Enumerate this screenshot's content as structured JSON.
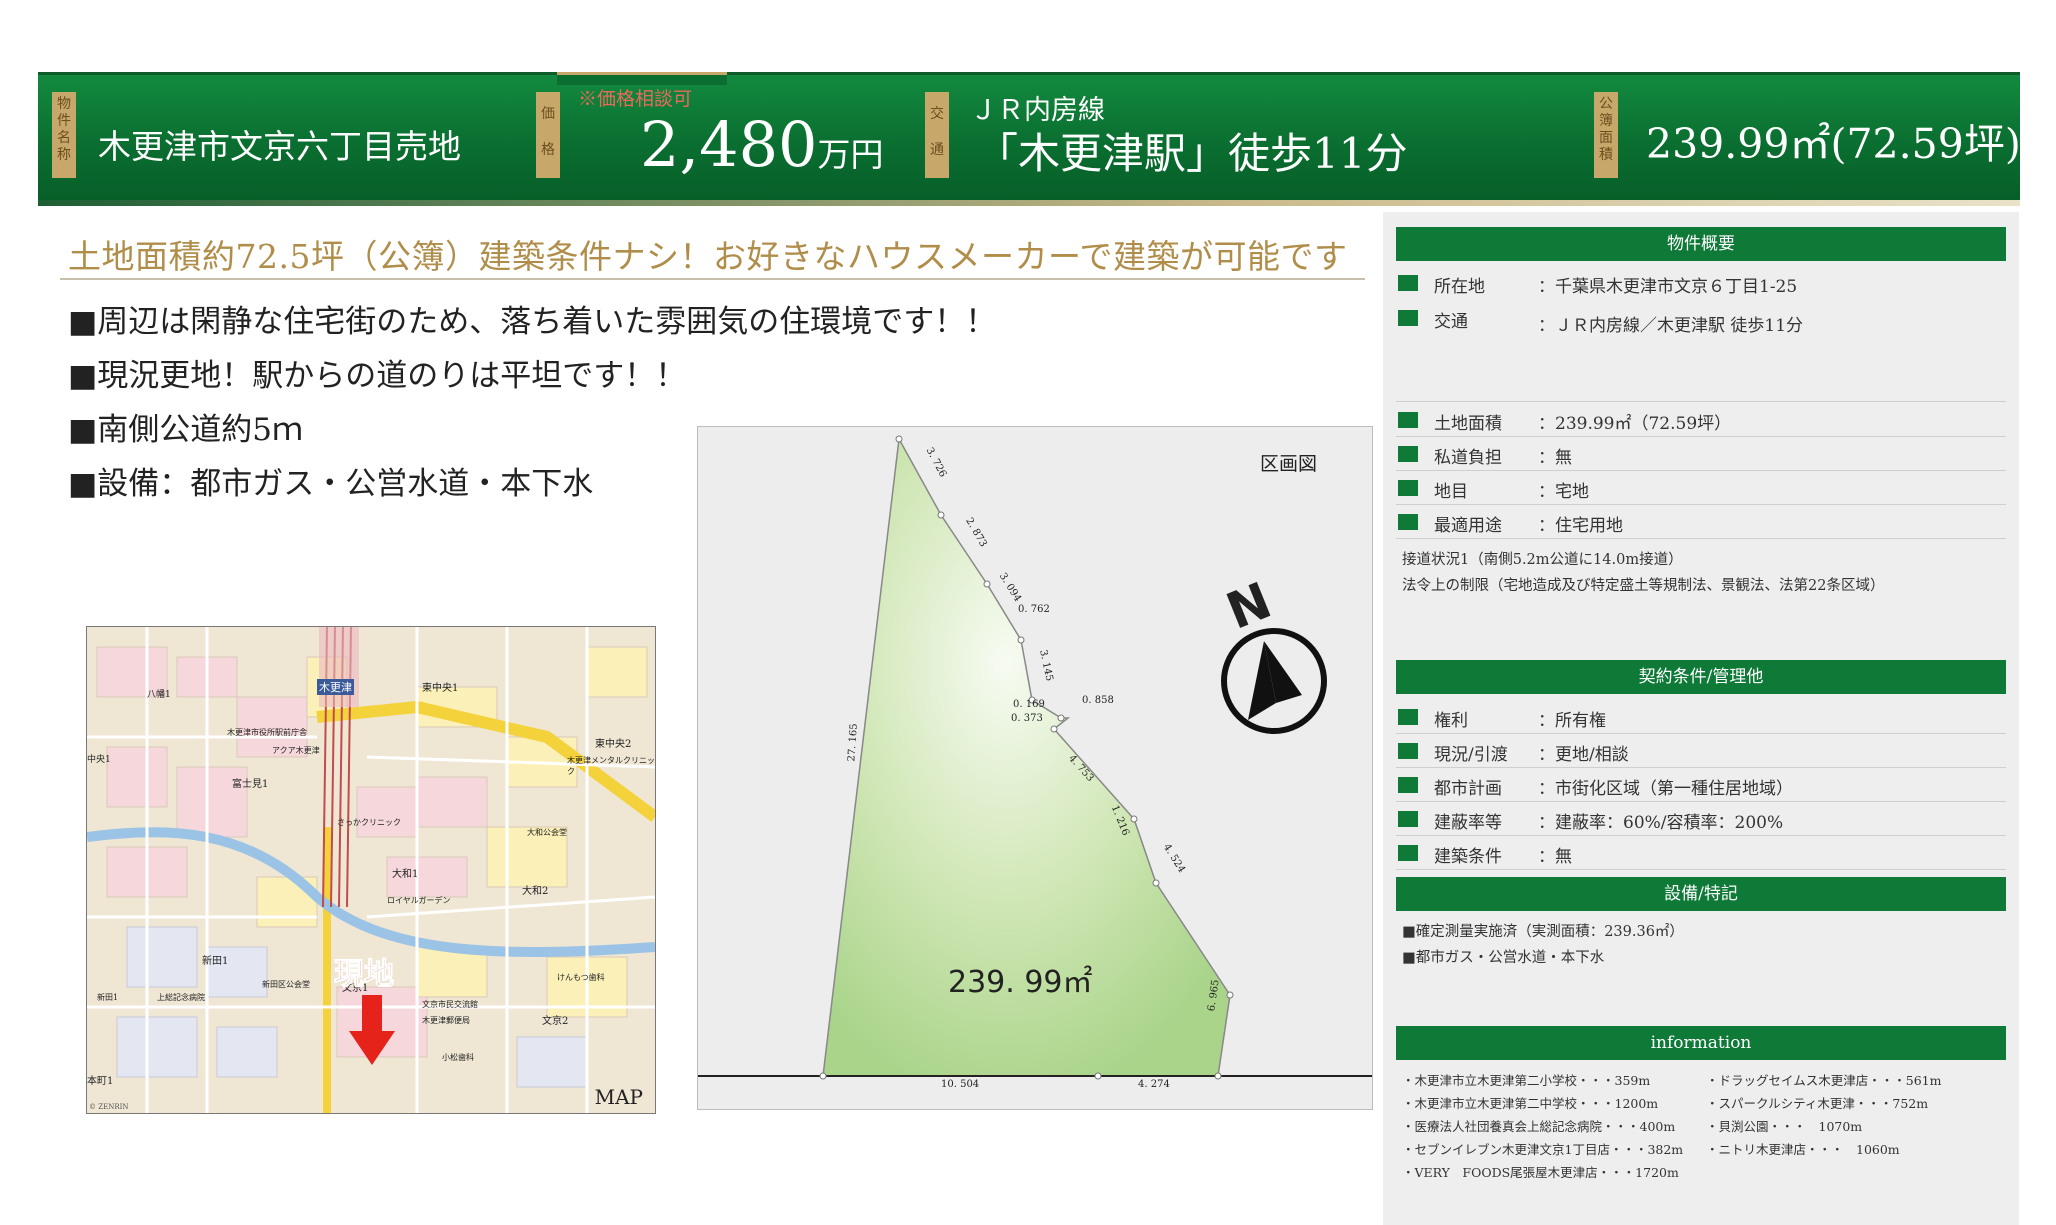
{
  "header": {
    "name_label": "物件名称",
    "property_name": "木更津市文京六丁目売地",
    "price_label": "価格",
    "price_note": "※価格相談可",
    "price_value": "2,480",
    "price_unit": "万円",
    "access_label": "交通",
    "access_line": "ＪＲ内房線",
    "access_station": "「木更津駅」徒歩11分",
    "area_label": "公簿面積",
    "area_value": "239.99㎡(72.59坪)"
  },
  "main": {
    "catch_copy": "土地面積約72.5坪（公簿）建築条件ナシ！お好きなハウスメーカーで建築が可能です",
    "bullets": [
      "■周辺は閑静な住宅街のため、落ち着いた雰囲気の住環境です！！",
      "■現況更地！駅からの道のりは平坦です！！",
      "■南側公道約5ｍ",
      "■設備：都市ガス・公営水道・本下水"
    ]
  },
  "map": {
    "caption": "MAP",
    "current_location": "現地",
    "labels": [
      "木更津",
      "東中央1",
      "東中央2",
      "富士見1",
      "大和1",
      "大和2",
      "新田1",
      "文京1",
      "文京2",
      "本町1",
      "八幡1",
      "中央1",
      "木更津市役所駅前庁舎",
      "木更津メンタルクリニック",
      "アクア木更津",
      "さっかクリニック",
      "ロイヤルガーデン",
      "けんもつ歯科",
      "文京市民交流館",
      "小松歯科",
      "上総記念病院",
      "新田区公会堂",
      "木更津郵便局",
      "大和公会堂",
      "新田1"
    ],
    "copyright": "© ZENRIN"
  },
  "plot": {
    "title": "区画図",
    "area": "239. 99㎡",
    "north": "N",
    "dimensions": [
      "3. 726",
      "2. 873",
      "3. 094",
      "0. 762",
      "3. 145",
      "0. 169",
      "0. 858",
      "0. 373",
      "4. 753",
      "1. 216",
      "4. 524",
      "6. 965",
      "4. 274",
      "10. 504",
      "27. 165"
    ]
  },
  "summary": {
    "title": "物件概要",
    "rows1": [
      {
        "label": "所在地",
        "value": "：千葉県木更津市文京６丁目1-25"
      },
      {
        "label": "交通",
        "value": "：ＪＲ内房線／木更津駅 徒歩11分"
      }
    ],
    "rows2": [
      {
        "label": "土地面積",
        "value": "：239.99㎡（72.59坪）"
      },
      {
        "label": "私道負担",
        "value": "：無"
      },
      {
        "label": "地目",
        "value": "：宅地"
      },
      {
        "label": "最適用途",
        "value": "：住宅用地"
      }
    ],
    "note1": "接道状況1（南側5.2m公道に14.0m接道）",
    "note2": "法令上の制限（宅地造成及び特定盛土等規制法、景観法、法第22条区域）"
  },
  "contract": {
    "title": "契約条件/管理他",
    "rows": [
      {
        "label": "権利",
        "value": "：所有権"
      },
      {
        "label": "現況/引渡",
        "value": "：更地/相談"
      },
      {
        "label": "都市計画",
        "value": "：市街化区域（第一種住居地域）"
      },
      {
        "label": "建蔽率等",
        "value": "：建蔽率：60%/容積率：200%"
      },
      {
        "label": "建築条件",
        "value": "：無"
      }
    ]
  },
  "equipment": {
    "title": "設備/特記",
    "items": [
      "■確定測量実施済（実測面積：239.36㎡）",
      "■都市ガス・公営水道・本下水"
    ]
  },
  "information": {
    "title": "information",
    "left": [
      "・木更津市立木更津第二小学校・・・359m",
      "・木更津市立木更津第二中学校・・・1200m",
      "・医療法人社団養真会上総記念病院・・・400m",
      "・セブンイレブン木更津文京1丁目店・・・382m",
      "・VERY　FOODS尾張屋木更津店・・・1720m"
    ],
    "right": [
      "・ドラッグセイムス木更津店・・・561m",
      "・スパークルシティ木更津・・・752m",
      "・貝渕公園・・・　1070m",
      "・ニトリ木更津店・・・　1060m"
    ]
  }
}
